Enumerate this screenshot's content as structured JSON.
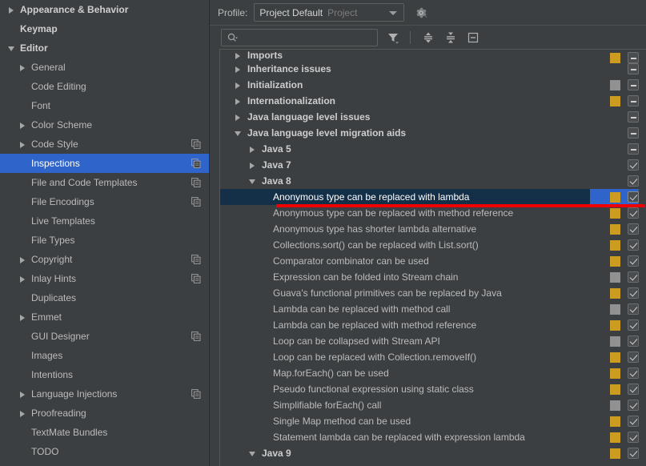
{
  "sidebar": {
    "items": [
      {
        "label": "Appearance & Behavior",
        "twisty": "closed",
        "indent": 8,
        "bold": true,
        "copy": false,
        "selected": false
      },
      {
        "label": "Keymap",
        "twisty": "none",
        "indent": 25,
        "bold": true,
        "copy": false,
        "selected": false
      },
      {
        "label": "Editor",
        "twisty": "open",
        "indent": 8,
        "bold": true,
        "copy": false,
        "selected": false
      },
      {
        "label": "General",
        "twisty": "closed",
        "indent": 22,
        "bold": false,
        "copy": false,
        "selected": false
      },
      {
        "label": "Code Editing",
        "twisty": "none",
        "indent": 39,
        "bold": false,
        "copy": false,
        "selected": false
      },
      {
        "label": "Font",
        "twisty": "none",
        "indent": 39,
        "bold": false,
        "copy": false,
        "selected": false
      },
      {
        "label": "Color Scheme",
        "twisty": "closed",
        "indent": 22,
        "bold": false,
        "copy": false,
        "selected": false
      },
      {
        "label": "Code Style",
        "twisty": "closed",
        "indent": 22,
        "bold": false,
        "copy": true,
        "selected": false
      },
      {
        "label": "Inspections",
        "twisty": "none",
        "indent": 39,
        "bold": false,
        "copy": true,
        "selected": true
      },
      {
        "label": "File and Code Templates",
        "twisty": "none",
        "indent": 39,
        "bold": false,
        "copy": true,
        "selected": false
      },
      {
        "label": "File Encodings",
        "twisty": "none",
        "indent": 39,
        "bold": false,
        "copy": true,
        "selected": false
      },
      {
        "label": "Live Templates",
        "twisty": "none",
        "indent": 39,
        "bold": false,
        "copy": false,
        "selected": false
      },
      {
        "label": "File Types",
        "twisty": "none",
        "indent": 39,
        "bold": false,
        "copy": false,
        "selected": false
      },
      {
        "label": "Copyright",
        "twisty": "closed",
        "indent": 22,
        "bold": false,
        "copy": true,
        "selected": false
      },
      {
        "label": "Inlay Hints",
        "twisty": "closed",
        "indent": 22,
        "bold": false,
        "copy": true,
        "selected": false
      },
      {
        "label": "Duplicates",
        "twisty": "none",
        "indent": 39,
        "bold": false,
        "copy": false,
        "selected": false
      },
      {
        "label": "Emmet",
        "twisty": "closed",
        "indent": 22,
        "bold": false,
        "copy": false,
        "selected": false
      },
      {
        "label": "GUI Designer",
        "twisty": "none",
        "indent": 39,
        "bold": false,
        "copy": true,
        "selected": false
      },
      {
        "label": "Images",
        "twisty": "none",
        "indent": 39,
        "bold": false,
        "copy": false,
        "selected": false
      },
      {
        "label": "Intentions",
        "twisty": "none",
        "indent": 39,
        "bold": false,
        "copy": false,
        "selected": false
      },
      {
        "label": "Language Injections",
        "twisty": "closed",
        "indent": 22,
        "bold": false,
        "copy": true,
        "selected": false
      },
      {
        "label": "Proofreading",
        "twisty": "closed",
        "indent": 22,
        "bold": false,
        "copy": false,
        "selected": false
      },
      {
        "label": "TextMate Bundles",
        "twisty": "none",
        "indent": 39,
        "bold": false,
        "copy": false,
        "selected": false
      },
      {
        "label": "TODO",
        "twisty": "none",
        "indent": 39,
        "bold": false,
        "copy": false,
        "selected": false
      }
    ]
  },
  "profile_bar": {
    "label": "Profile:",
    "selected_profile": "Project Default",
    "profile_scope": "Project",
    "gear_icon": "gear-icon"
  },
  "toolbar": {
    "search_placeholder": "",
    "search_value": "",
    "search_icon": "search-icon",
    "filter_icon": "filter-icon",
    "expand_all_icon": "expand-all-icon",
    "collapse_all_icon": "collapse-all-icon",
    "reset_icon": "reset-icon"
  },
  "tree": {
    "rows": [
      {
        "label": "Imports",
        "twisty": "closed",
        "indent": 16,
        "group": true,
        "severity": "warn",
        "check": "dash",
        "selected": false,
        "clipped": true
      },
      {
        "label": "Inheritance issues",
        "twisty": "closed",
        "indent": 16,
        "group": true,
        "severity": "none",
        "check": "dash",
        "selected": false
      },
      {
        "label": "Initialization",
        "twisty": "closed",
        "indent": 16,
        "group": true,
        "severity": "gray",
        "check": "dash",
        "selected": false
      },
      {
        "label": "Internationalization",
        "twisty": "closed",
        "indent": 16,
        "group": true,
        "severity": "warn",
        "check": "dash",
        "selected": false
      },
      {
        "label": "Java language level issues",
        "twisty": "closed",
        "indent": 16,
        "group": true,
        "severity": "none",
        "check": "dash",
        "selected": false
      },
      {
        "label": "Java language level migration aids",
        "twisty": "open",
        "indent": 16,
        "group": true,
        "severity": "none",
        "check": "dash",
        "selected": false
      },
      {
        "label": "Java 5",
        "twisty": "closed",
        "indent": 34,
        "group": true,
        "severity": "none",
        "check": "dash",
        "selected": false
      },
      {
        "label": "Java 7",
        "twisty": "closed",
        "indent": 34,
        "group": true,
        "severity": "none",
        "check": "checked",
        "selected": false
      },
      {
        "label": "Java 8",
        "twisty": "open",
        "indent": 34,
        "group": true,
        "severity": "none",
        "check": "checked",
        "selected": false
      },
      {
        "label": "Anonymous type can be replaced with lambda",
        "twisty": "none",
        "indent": 66,
        "group": false,
        "severity": "warn",
        "check": "checked",
        "selected": true
      },
      {
        "label": "Anonymous type can be replaced with method reference",
        "twisty": "none",
        "indent": 66,
        "group": false,
        "severity": "warn",
        "check": "checked",
        "selected": false
      },
      {
        "label": "Anonymous type has shorter lambda alternative",
        "twisty": "none",
        "indent": 66,
        "group": false,
        "severity": "warn",
        "check": "checked",
        "selected": false
      },
      {
        "label": "Collections.sort() can be replaced with List.sort()",
        "twisty": "none",
        "indent": 66,
        "group": false,
        "severity": "warn",
        "check": "checked",
        "selected": false
      },
      {
        "label": "Comparator combinator can be used",
        "twisty": "none",
        "indent": 66,
        "group": false,
        "severity": "warn",
        "check": "checked",
        "selected": false
      },
      {
        "label": "Expression can be folded into Stream chain",
        "twisty": "none",
        "indent": 66,
        "group": false,
        "severity": "gray",
        "check": "checked",
        "selected": false
      },
      {
        "label": "Guava's functional primitives can be replaced by Java",
        "twisty": "none",
        "indent": 66,
        "group": false,
        "severity": "warn",
        "check": "checked",
        "selected": false
      },
      {
        "label": "Lambda can be replaced with method call",
        "twisty": "none",
        "indent": 66,
        "group": false,
        "severity": "gray",
        "check": "checked",
        "selected": false
      },
      {
        "label": "Lambda can be replaced with method reference",
        "twisty": "none",
        "indent": 66,
        "group": false,
        "severity": "warn",
        "check": "checked",
        "selected": false
      },
      {
        "label": "Loop can be collapsed with Stream API",
        "twisty": "none",
        "indent": 66,
        "group": false,
        "severity": "gray",
        "check": "checked",
        "selected": false
      },
      {
        "label": "Loop can be replaced with Collection.removeIf()",
        "twisty": "none",
        "indent": 66,
        "group": false,
        "severity": "warn",
        "check": "checked",
        "selected": false
      },
      {
        "label": "Map.forEach() can be used",
        "twisty": "none",
        "indent": 66,
        "group": false,
        "severity": "warn",
        "check": "checked",
        "selected": false
      },
      {
        "label": "Pseudo functional expression using static class",
        "twisty": "none",
        "indent": 66,
        "group": false,
        "severity": "warn",
        "check": "checked",
        "selected": false
      },
      {
        "label": "Simplifiable forEach() call",
        "twisty": "none",
        "indent": 66,
        "group": false,
        "severity": "gray",
        "check": "checked",
        "selected": false
      },
      {
        "label": "Single Map method can be used",
        "twisty": "none",
        "indent": 66,
        "group": false,
        "severity": "warn",
        "check": "checked",
        "selected": false
      },
      {
        "label": "Statement lambda can be replaced with expression lambda",
        "twisty": "none",
        "indent": 66,
        "group": false,
        "severity": "warn",
        "check": "checked",
        "selected": false
      },
      {
        "label": "Java 9",
        "twisty": "open",
        "indent": 34,
        "group": true,
        "severity": "warn",
        "check": "checked",
        "selected": false
      }
    ]
  },
  "annotation": {
    "type": "red-underline",
    "color": "#ee0000",
    "target_row": "Anonymous type can be replaced with lambda"
  },
  "colors": {
    "background": "#3c3f41",
    "selection_blue": "#2f65ca",
    "tree_selection": "#143049",
    "severity_warning": "#cc9c20",
    "severity_gray": "#919191",
    "text": "#bbbbbb"
  }
}
